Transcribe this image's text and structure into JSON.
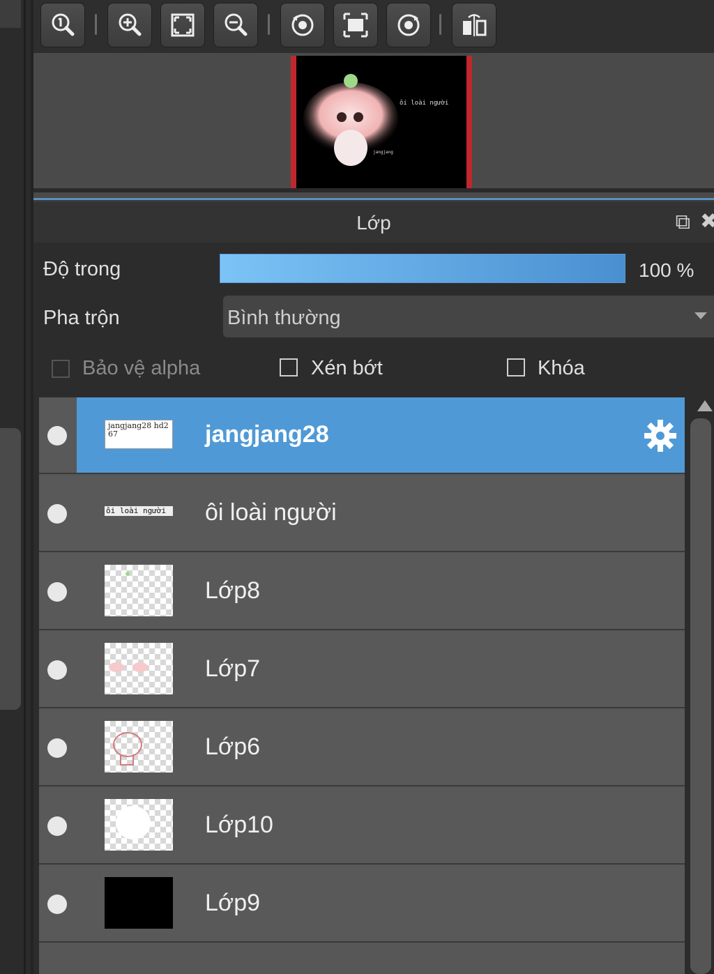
{
  "toolbar": {
    "buttons": [
      {
        "name": "zoom-actual-icon"
      },
      {
        "name": "zoom-in-icon"
      },
      {
        "name": "fit-screen-icon"
      },
      {
        "name": "zoom-out-icon"
      },
      {
        "name": "rotate-left-icon"
      },
      {
        "name": "fit-frame-icon"
      },
      {
        "name": "rotate-right-icon"
      },
      {
        "name": "flip-horizontal-icon"
      }
    ]
  },
  "navigator": {
    "preview_text": "ôi loài người",
    "preview_small_text": "jangjang"
  },
  "panel": {
    "title": "Lớp"
  },
  "opacity": {
    "label": "Độ trong",
    "value": "100 %",
    "percent": 100
  },
  "blend": {
    "label": "Pha trộn",
    "value": "Bình thường"
  },
  "options": {
    "protect_alpha": "Bảo vệ alpha",
    "clipping": "Xén bớt",
    "lock": "Khóa"
  },
  "layers": [
    {
      "name": "jangjang28",
      "thumb_text": "jangjang28 hd267",
      "selected": true
    },
    {
      "name": "ôi loài người",
      "thumb_text": "ôi loài người"
    },
    {
      "name": "Lớp8"
    },
    {
      "name": "Lớp7"
    },
    {
      "name": "Lớp6"
    },
    {
      "name": "Lớp10"
    },
    {
      "name": "Lớp9"
    }
  ],
  "colors": {
    "accent": "#4f9ad6",
    "preview_border": "#c0272d"
  }
}
